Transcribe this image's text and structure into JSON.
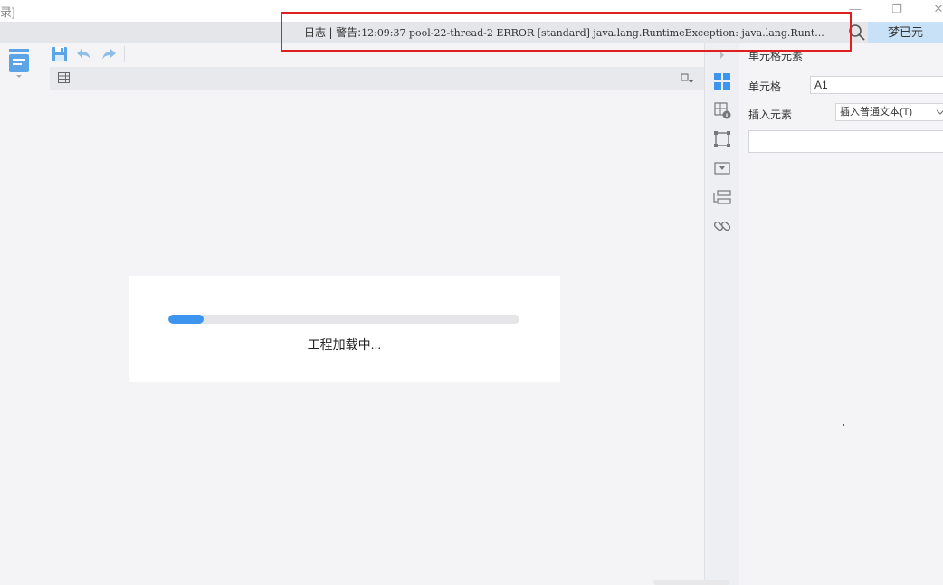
{
  "window": {
    "title_fragment": "录]",
    "minimize_glyph": "—",
    "maximize_glyph": "❐",
    "close_glyph": "✕"
  },
  "statusbar": {
    "log_label": "日志",
    "separator": "|",
    "warning_label": "警告:",
    "log_message": "12:09:37 pool-22-thread-2 ERROR [standard] java.lang.RuntimeException: java.lang.Runt...",
    "user_name": "梦已元"
  },
  "loading": {
    "message": "工程加载中...",
    "progress_fraction": 0.1
  },
  "properties": {
    "title": "单元格元素",
    "cell_label": "单元格",
    "cell_value": "A1",
    "insert_label": "插入元素",
    "insert_value": "插入普通文本(T)"
  },
  "colors": {
    "accent": "#3d95ef",
    "highlight_border": "#e02020",
    "user_button_bg": "#c9e1f7"
  },
  "icons": {
    "toolbar": [
      "template-icon",
      "save-icon",
      "undo-icon",
      "redo-icon"
    ],
    "cellbar": [
      "grid-icon",
      "filter-icon"
    ],
    "strip": [
      "cell-element-icon",
      "cell-attribute-icon",
      "float-element-icon",
      "widget-icon",
      "condition-icon",
      "hyperlink-icon"
    ]
  }
}
